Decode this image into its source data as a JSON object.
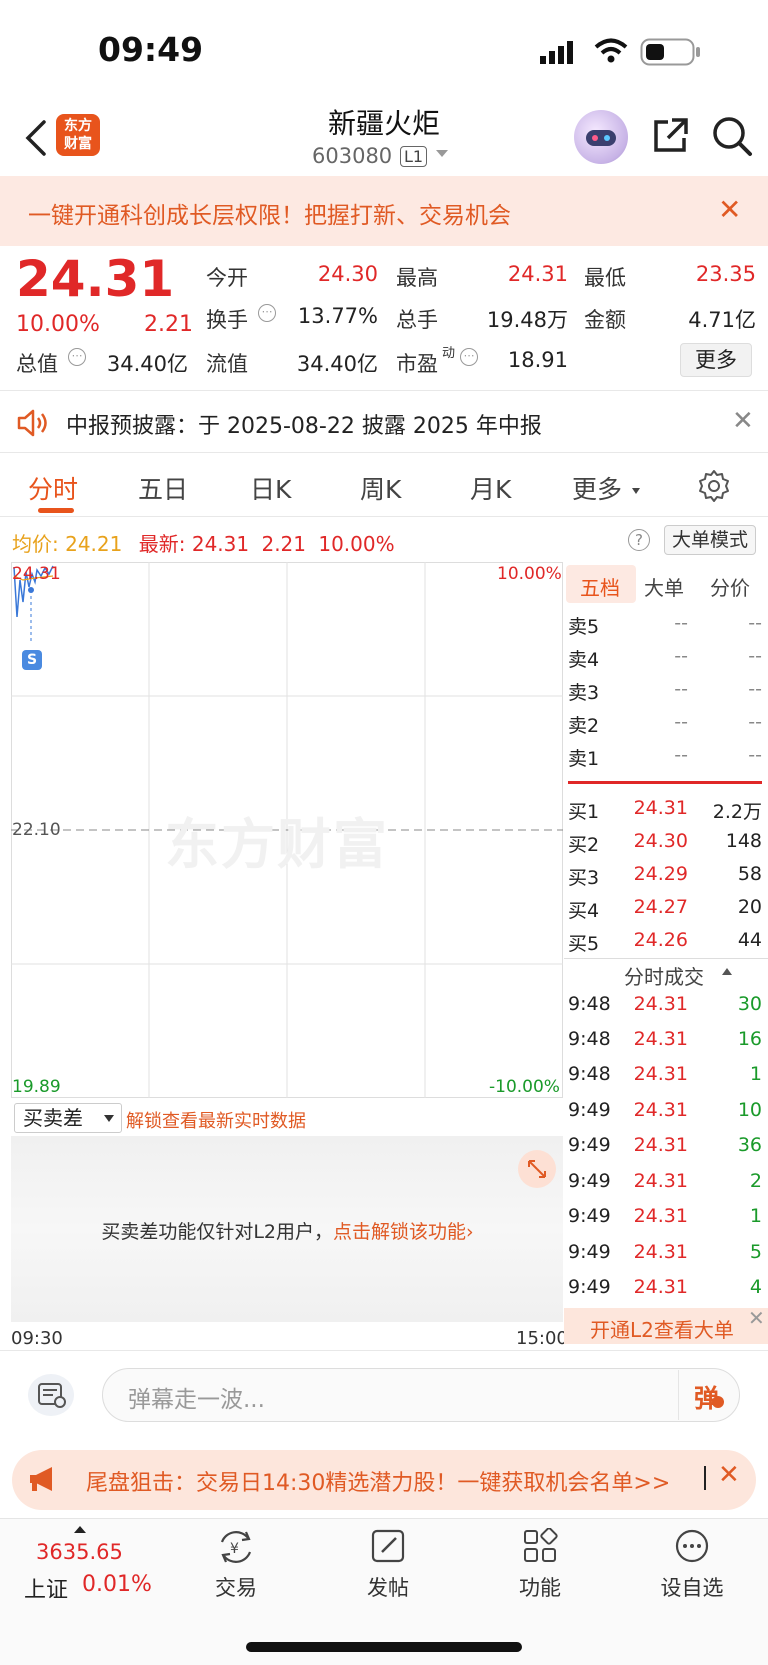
{
  "status_bar": {
    "time": "09:49"
  },
  "header": {
    "logo": "东方\n财富",
    "stock_name": "新疆火炬",
    "stock_code": "603080",
    "level": "L1"
  },
  "banner": {
    "text": "一键开通科创成长层权限！把握打新、交易机会",
    "close": "✕"
  },
  "quote": {
    "price": "24.31",
    "change_pct": "10.00%",
    "change_abs": "2.21",
    "open_label": "今开",
    "open": "24.30",
    "high_label": "最高",
    "high": "24.31",
    "low_label": "最低",
    "low": "23.35",
    "turnover_label": "换手",
    "turnover": "13.77%",
    "volume_label": "总手",
    "volume": "19.48万",
    "amount_label": "金额",
    "amount": "4.71亿",
    "mcap_label": "总值",
    "mcap": "34.40亿",
    "float_label": "流值",
    "float_mcap": "34.40亿",
    "pe_label": "市盈",
    "pe_sup": "动",
    "pe": "18.91",
    "more": "更多"
  },
  "notice": {
    "text": "中报预披露：于 2025-08-22 披露 2025 年中报",
    "close": "✕"
  },
  "tabs": [
    "分时",
    "五日",
    "日K",
    "周K",
    "月K",
    "更多"
  ],
  "info_line": {
    "avg_label": "均价:",
    "avg": "24.21",
    "last_label": "最新:",
    "last": "24.31",
    "change": "2.21",
    "pct": "10.00%",
    "big_order_mode": "大单模式"
  },
  "chart": {
    "y_top_left": "24.31",
    "y_top_right": "10.00%",
    "y_mid": "22.10",
    "y_bottom_left": "19.89",
    "y_bottom_right": "-10.00%",
    "marker": "S",
    "watermark": "东方财富",
    "time_start": "09:30",
    "time_end": "15:00"
  },
  "orderbook": {
    "tabs": [
      "五档",
      "大单",
      "分价"
    ],
    "asks": [
      {
        "label": "卖5",
        "price": "--",
        "vol": "--"
      },
      {
        "label": "卖4",
        "price": "--",
        "vol": "--"
      },
      {
        "label": "卖3",
        "price": "--",
        "vol": "--"
      },
      {
        "label": "卖2",
        "price": "--",
        "vol": "--"
      },
      {
        "label": "卖1",
        "price": "--",
        "vol": "--"
      }
    ],
    "bids": [
      {
        "label": "买1",
        "price": "24.31",
        "vol": "2.2万"
      },
      {
        "label": "买2",
        "price": "24.30",
        "vol": "148"
      },
      {
        "label": "买3",
        "price": "24.29",
        "vol": "58"
      },
      {
        "label": "买4",
        "price": "24.27",
        "vol": "20"
      },
      {
        "label": "买5",
        "price": "24.26",
        "vol": "44"
      }
    ],
    "trades_title": "分时成交",
    "trades": [
      {
        "time": "9:48",
        "price": "24.31",
        "vol": "30"
      },
      {
        "time": "9:48",
        "price": "24.31",
        "vol": "16"
      },
      {
        "time": "9:48",
        "price": "24.31",
        "vol": "1"
      },
      {
        "time": "9:49",
        "price": "24.31",
        "vol": "10"
      },
      {
        "time": "9:49",
        "price": "24.31",
        "vol": "36"
      },
      {
        "time": "9:49",
        "price": "24.31",
        "vol": "2"
      },
      {
        "time": "9:49",
        "price": "24.31",
        "vol": "1"
      },
      {
        "time": "9:49",
        "price": "24.31",
        "vol": "5"
      },
      {
        "time": "9:49",
        "price": "24.31",
        "vol": "4"
      }
    ],
    "l2_banner": "开通L2查看大单"
  },
  "spread": {
    "select": "买卖差",
    "unlock_link": "解锁查看最新实时数据",
    "message": "买卖差功能仅针对L2用户，",
    "message_link": "点击解锁该功能",
    "message_link_arrow": "›"
  },
  "comment": {
    "placeholder": "弹幕走一波...",
    "danmu_char": "弹"
  },
  "promo": {
    "text": "尾盘狙击：交易日14:30精选潜力股！一键获取机会名单>>",
    "close": "✕"
  },
  "bottom_nav": {
    "index_value": "3635.65",
    "index_name": "上证",
    "index_pct": "0.01%",
    "items": [
      "交易",
      "发帖",
      "功能",
      "设自选"
    ]
  }
}
